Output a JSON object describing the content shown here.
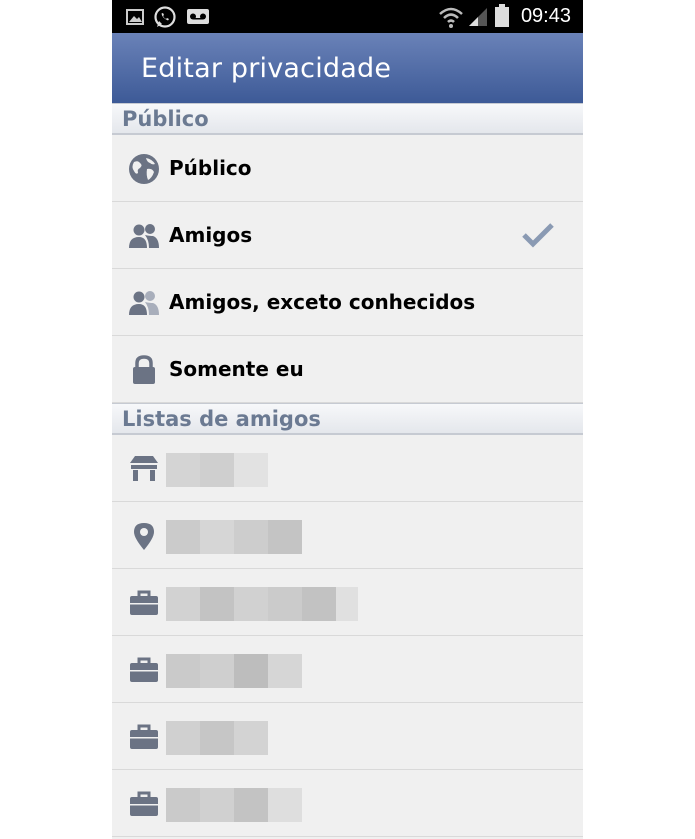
{
  "status_bar": {
    "time": "09:43",
    "icons": [
      "image-icon",
      "whatsapp-icon",
      "voicemail-icon",
      "wifi-icon",
      "signal-icon",
      "battery-icon"
    ]
  },
  "header": {
    "title": "Editar privacidade"
  },
  "sections": {
    "public": {
      "label": "Público",
      "options": [
        {
          "label": "Público",
          "icon": "globe-icon",
          "selected": false
        },
        {
          "label": "Amigos",
          "icon": "friends-icon",
          "selected": true
        },
        {
          "label": "Amigos, exceto conhecidos",
          "icon": "friends-except-icon",
          "selected": false
        },
        {
          "label": "Somente eu",
          "icon": "lock-icon",
          "selected": false
        }
      ]
    },
    "friend_lists": {
      "label": "Listas de amigos",
      "items": [
        {
          "icon": "school-icon"
        },
        {
          "icon": "location-pin-icon"
        },
        {
          "icon": "briefcase-icon"
        },
        {
          "icon": "briefcase-icon"
        },
        {
          "icon": "briefcase-icon"
        },
        {
          "icon": "briefcase-icon"
        }
      ]
    }
  },
  "colors": {
    "header_top": "#6a82b8",
    "header_bottom": "#3d5a97",
    "section_text": "#6b7a92",
    "icon": "#6b7384",
    "check": "#8a9ab3"
  }
}
